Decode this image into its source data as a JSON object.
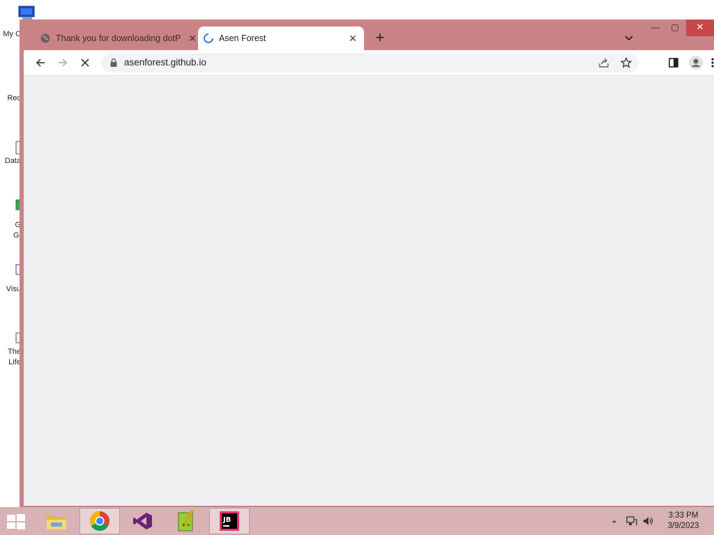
{
  "desktop": {
    "icons": [
      {
        "name": "desktop-icon-my-computer",
        "label": "My C"
      },
      {
        "name": "desktop-icon-recycle-bin",
        "label": "Rec"
      },
      {
        "name": "desktop-icon-data",
        "label": "Data"
      },
      {
        "name": "desktop-icon-g",
        "label": "G"
      },
      {
        "name": "desktop-icon-visual-studio",
        "label": "Visu"
      },
      {
        "name": "desktop-icon-the-life",
        "label": "The"
      }
    ],
    "extra_labels": {
      "g2": "Gi",
      "the2": "Life"
    }
  },
  "browser": {
    "tabs": [
      {
        "title": "Thank you for downloading dotP",
        "active": false,
        "close": "✕"
      },
      {
        "title": "Asen Forest",
        "active": true,
        "loading": true,
        "close": "✕"
      }
    ],
    "new_tab": "+",
    "address_bar": {
      "url": "asenforest.github.io",
      "secure": true
    },
    "window_controls": {
      "minimize": "—",
      "maximize": "▢",
      "close": "✕"
    }
  },
  "taskbar": {
    "apps": [
      "file-explorer",
      "chrome",
      "visual-studio",
      "notepad-plus-plus",
      "jetbrains"
    ],
    "active_app": "chrome",
    "clock": {
      "time": "3:33 PM",
      "date": "3/9/2023"
    }
  },
  "colors": {
    "window_frame": "#c98386",
    "taskbar": "#d8b2b4",
    "close_button": "#c8474b",
    "page_bg": "#f0f0f3"
  }
}
